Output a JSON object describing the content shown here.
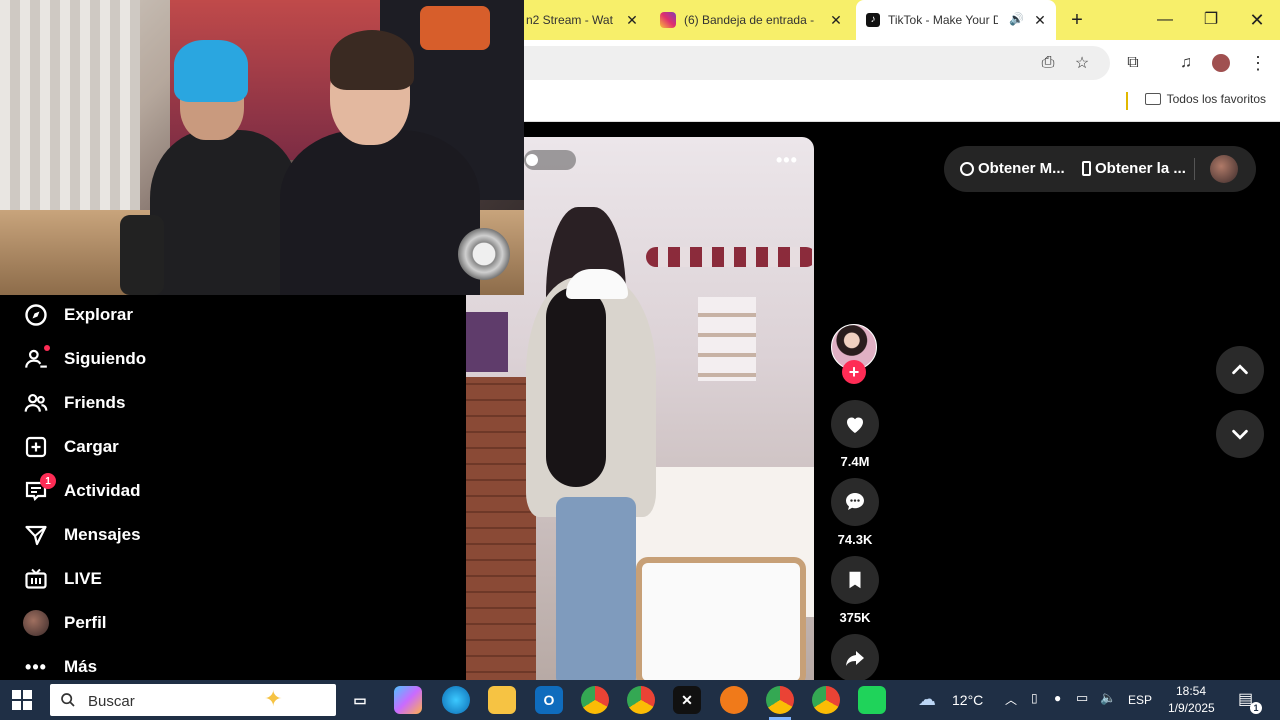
{
  "browser": {
    "tabs": [
      {
        "label": "n2 Stream - Wat"
      },
      {
        "label": "(6) Bandeja de entrada - "
      },
      {
        "label": "TikTok - Make Your D"
      }
    ],
    "favorites_label": "Todos los favoritos"
  },
  "sidebar": {
    "items": [
      {
        "label": "Explorar"
      },
      {
        "label": "Siguiendo"
      },
      {
        "label": "Friends"
      },
      {
        "label": "Cargar"
      },
      {
        "label": "Actividad",
        "badge": "1"
      },
      {
        "label": "Mensajes"
      },
      {
        "label": "LIVE"
      },
      {
        "label": "Perfil"
      },
      {
        "label": "Más"
      }
    ]
  },
  "video": {
    "likes": "7.4M",
    "comments": "74.3K",
    "saves": "375K"
  },
  "top_chips": {
    "chip1": "Obtener M...",
    "chip2": "Obtener la ..."
  },
  "taskbar": {
    "search_label": "Buscar",
    "weather": "12°C",
    "lang": "ESP",
    "time": "18:54",
    "date": "1/9/2025",
    "notif_count": "1"
  },
  "colors": {
    "tiktok_red": "#fe2c55",
    "tab_bar": "#f7ef6a",
    "taskbar": "#1f2f45"
  }
}
